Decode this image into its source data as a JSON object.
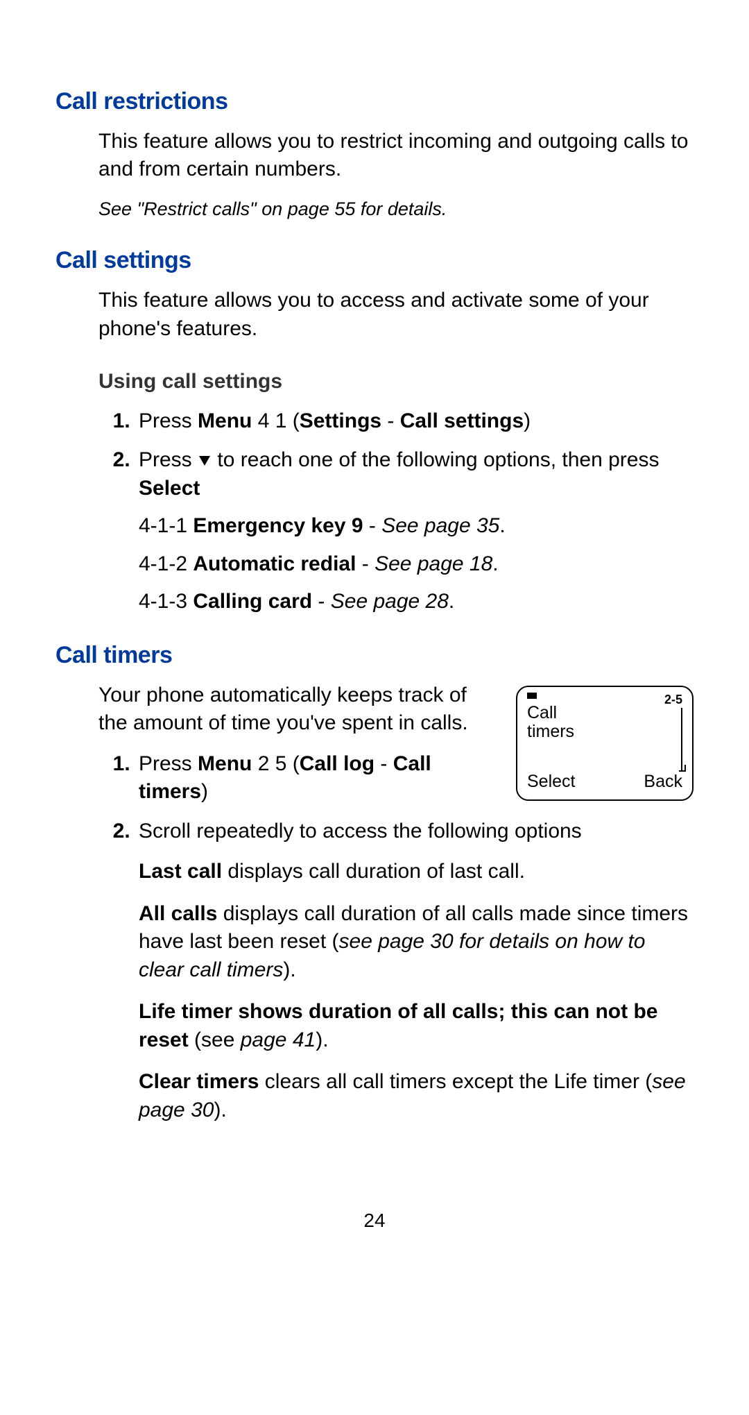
{
  "s1": {
    "heading": "Call restrictions",
    "intro": "This feature allows you to restrict incoming and outgoing calls to and from certain numbers.",
    "note": "See \"Restrict calls\" on page 55 for details."
  },
  "s2": {
    "heading": "Call settings",
    "intro": "This feature allows you to access and activate some of your phone's features.",
    "subheading": "Using call settings",
    "step1_a": "Press ",
    "step1_menu": "Menu",
    "step1_b": " 4 1 (",
    "step1_settings": "Settings",
    "step1_dash": " - ",
    "step1_callsettings": "Call settings",
    "step1_c": ")",
    "step2_a": "Press ",
    "step2_b": " to reach one of the following options, then press ",
    "step2_select": "Select",
    "opt1_pre": "4-1-1 ",
    "opt1_b": "Emergency key 9",
    "opt1_dash": " - ",
    "opt1_ref": "See page 35",
    "opt1_dot": ".",
    "opt2_pre": "4-1-2 ",
    "opt2_b": "Automatic redial",
    "opt2_dash": " - ",
    "opt2_ref": "See page 18",
    "opt2_dot": ".",
    "opt3_pre": "4-1-3 ",
    "opt3_b": "Calling card",
    "opt3_dash": " - ",
    "opt3_ref": "See page 28",
    "opt3_dot": "."
  },
  "s3": {
    "heading": "Call timers",
    "intro": "Your phone automatically keeps track of the amount of time you've spent in calls.",
    "step1_a": "Press ",
    "step1_menu": "Menu",
    "step1_b": " 2 5 (",
    "step1_calllog": "Call log",
    "step1_dash": " - ",
    "step1_timers": "Call timers",
    "step1_c": ")",
    "step2": "Scroll repeatedly to access the following options",
    "last_b": "Last call",
    "last_t": " displays call duration of last call.",
    "all_b": "All calls",
    "all_t1": " displays call duration of all calls made since timers have last been reset (",
    "all_i": "see page 30 for details on how to clear call timers",
    "all_t2": ").",
    "life_b": "Life timer shows duration of all calls; this can not be reset",
    "life_t1": " (see ",
    "life_i": "page 41",
    "life_t2": ").",
    "clear_b": "Clear timers",
    "clear_t1": " clears all call timers except the Life timer (",
    "clear_i": "see page 30",
    "clear_t2": ")."
  },
  "screen": {
    "menu_num": "2-5",
    "title_l1": "Call",
    "title_l2": "timers",
    "left": "Select",
    "right": "Back"
  },
  "page": "24"
}
